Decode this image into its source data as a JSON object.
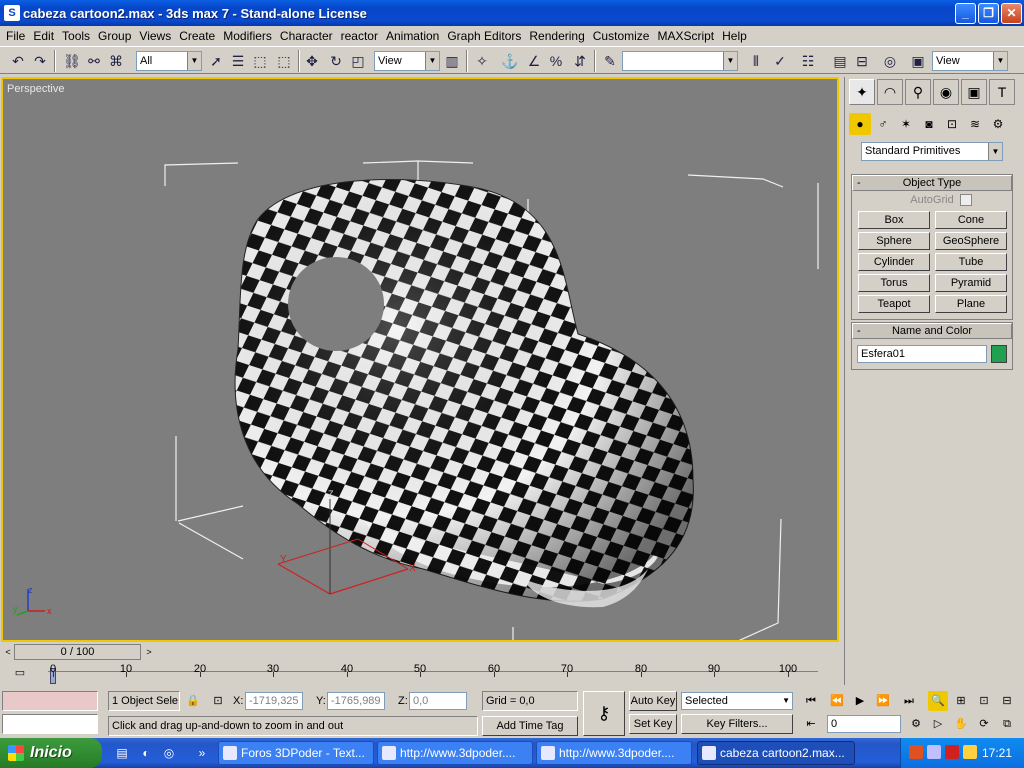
{
  "window": {
    "title": "cabeza cartoon2.max - 3ds max 7 - Stand-alone License",
    "app_icon": "3ds-max-icon",
    "buttons": [
      "minimize",
      "maximize",
      "close"
    ]
  },
  "menu": [
    "File",
    "Edit",
    "Tools",
    "Group",
    "Views",
    "Create",
    "Modifiers",
    "Character",
    "reactor",
    "Animation",
    "Graph Editors",
    "Rendering",
    "Customize",
    "MAXScript",
    "Help"
  ],
  "toolbar": {
    "selection_filter": "All",
    "ref_coord": "View",
    "named_selection": "",
    "viewport_render": "View"
  },
  "viewport": {
    "label": "Perspective",
    "border_color": "#f0c800",
    "background": "#7e7e7e",
    "object_name_hint": "Esfera01"
  },
  "command_panel": {
    "category": "Standard Primitives",
    "object_type": {
      "title": "Object Type",
      "autogrid_label": "AutoGrid",
      "buttons": [
        "Box",
        "Cone",
        "Sphere",
        "GeoSphere",
        "Cylinder",
        "Tube",
        "Torus",
        "Pyramid",
        "Teapot",
        "Plane"
      ]
    },
    "name_color": {
      "title": "Name and Color",
      "name": "Esfera01",
      "color": "#20a050"
    }
  },
  "timeline": {
    "frame_display": "0 / 100",
    "ticks": [
      "0",
      "10",
      "20",
      "30",
      "40",
      "50",
      "60",
      "70",
      "80",
      "90",
      "100"
    ]
  },
  "status": {
    "selection_info": "1 Object Sele",
    "x_label": "X:",
    "x_value": "-1719,325",
    "y_label": "Y:",
    "y_value": "-1765,989",
    "z_label": "Z:",
    "z_value": "0,0",
    "grid": "Grid = 0,0",
    "prompt": "Click and drag up-and-down to zoom in and out",
    "add_time_tag": "Add Time Tag",
    "auto_key": "Auto Key",
    "set_key": "Set Key",
    "key_mode": "Selected",
    "key_filters": "Key Filters...",
    "current_frame": "0"
  },
  "taskbar": {
    "start_label": "Inicio",
    "tasks": [
      "Foros 3DPoder - Text...",
      "http://www.3dpoder....",
      "http://www.3dpoder....",
      "cabeza cartoon2.max..."
    ],
    "clock": "17:21"
  }
}
